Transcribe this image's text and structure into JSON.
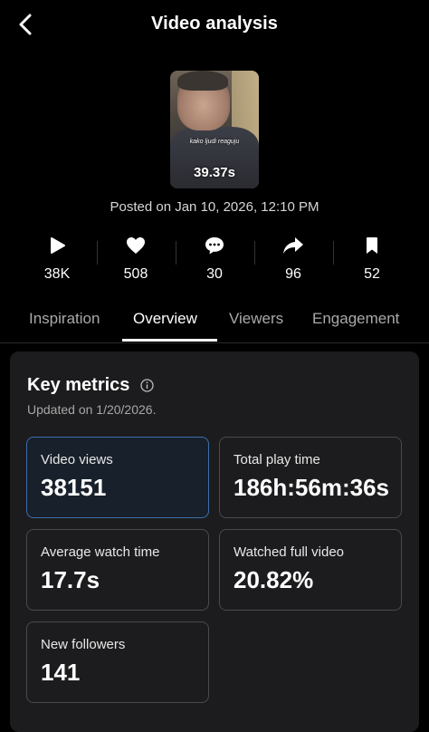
{
  "header": {
    "title": "Video analysis"
  },
  "video": {
    "caption": "kako ljudi reaguju",
    "duration": "39.37s",
    "posted": "Posted on Jan 10, 2026, 12:10 PM"
  },
  "stats": [
    {
      "icon": "play-icon",
      "value": "38K"
    },
    {
      "icon": "heart-icon",
      "value": "508"
    },
    {
      "icon": "comment-icon",
      "value": "30"
    },
    {
      "icon": "share-icon",
      "value": "96"
    },
    {
      "icon": "bookmark-icon",
      "value": "52"
    }
  ],
  "tabs": [
    {
      "label": "Inspiration"
    },
    {
      "label": "Overview",
      "active": true
    },
    {
      "label": "Viewers"
    },
    {
      "label": "Engagement"
    }
  ],
  "key_metrics": {
    "title": "Key metrics",
    "updated": "Updated on 1/20/2026.",
    "items": [
      {
        "label": "Video views",
        "value": "38151",
        "selected": true
      },
      {
        "label": "Total play time",
        "value": "186h:56m:36s"
      },
      {
        "label": "Average watch time",
        "value": "17.7s"
      },
      {
        "label": "Watched full video",
        "value": "20.82%"
      },
      {
        "label": "New followers",
        "value": "141"
      }
    ]
  },
  "colors": {
    "background": "#000000",
    "card": "#1c1c1e",
    "selected_border": "#3c6fa9",
    "muted_text": "#a7a7a7"
  }
}
